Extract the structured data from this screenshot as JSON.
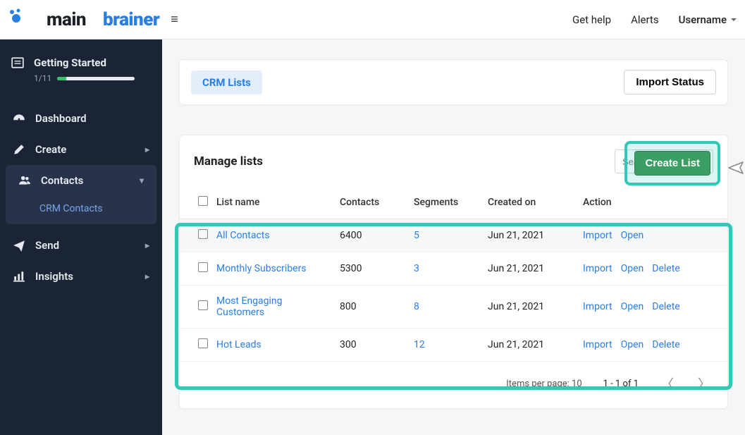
{
  "topbar": {
    "brand_main": "main",
    "brand_brainer": "brainer",
    "get_help": "Get help",
    "alerts": "Alerts",
    "username": "Username"
  },
  "sidebar": {
    "getting_started": {
      "title": "Getting Started",
      "progress": "1/11"
    },
    "items": [
      {
        "label": "Dashboard"
      },
      {
        "label": "Create"
      },
      {
        "label": "Contacts",
        "sub": "CRM Contacts"
      },
      {
        "label": "Send"
      },
      {
        "label": "Insights"
      }
    ]
  },
  "header_card": {
    "tab": "CRM Lists",
    "import_status": "Import Status"
  },
  "table": {
    "title": "Manage lists",
    "search_placeholder": "Search List",
    "create_button": "Create List",
    "columns": [
      "",
      "List name",
      "Contacts",
      "Segments",
      "Created on",
      "Action"
    ],
    "rows": [
      {
        "name": "All Contacts",
        "contacts": "6400",
        "segments": "5",
        "created": "Jun 21, 2021",
        "actions": [
          "Import",
          "Open"
        ]
      },
      {
        "name": "Monthly Subscribers",
        "contacts": "5300",
        "segments": "3",
        "created": "Jun 21, 2021",
        "actions": [
          "Import",
          "Open",
          "Delete"
        ]
      },
      {
        "name": "Most Engaging Customers",
        "contacts": "800",
        "segments": "8",
        "created": "Jun 21, 2021",
        "actions": [
          "Import",
          "Open",
          "Delete"
        ]
      },
      {
        "name": "Hot Leads",
        "contacts": "300",
        "segments": "12",
        "created": "Jun 21, 2021",
        "actions": [
          "Import",
          "Open",
          "Delete"
        ]
      }
    ],
    "pager": {
      "items_per_page": "Items per page: 10",
      "range": "1 - 1 of 1"
    }
  }
}
